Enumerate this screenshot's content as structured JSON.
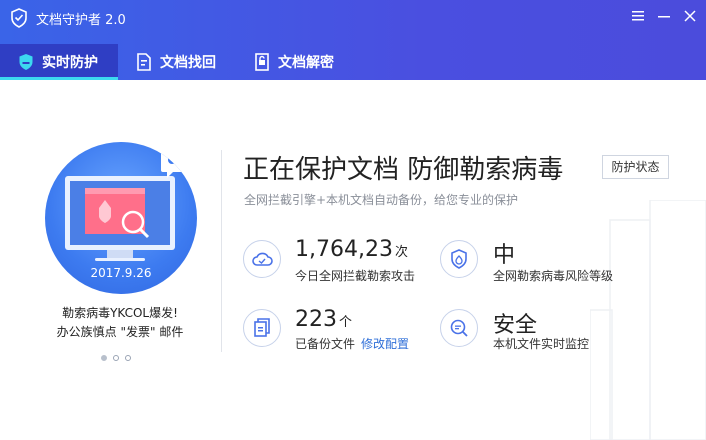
{
  "app": {
    "title": "文档守护者 2.0"
  },
  "tabs": [
    {
      "label": "实时防护",
      "icon": "shield-icon",
      "active": true
    },
    {
      "label": "文档找回",
      "icon": "document-restore-icon",
      "active": false
    },
    {
      "label": "文档解密",
      "icon": "document-unlock-icon",
      "active": false
    }
  ],
  "promo": {
    "date": "2017.9.26",
    "caption_line1": "勒索病毒YKCOL爆发!",
    "caption_line2": "办公族慎点 \"发票\" 邮件",
    "pages": 3,
    "active_page": 1
  },
  "main": {
    "headline": "正在保护文档 防御勒索病毒",
    "status_button": "防护状态",
    "subline": "全网拦截引擎+本机文档自动备份，给您专业的保护"
  },
  "stats": {
    "blocked": {
      "value": "1,764,23",
      "unit": "次",
      "label": "今日全网拦截勒索攻击"
    },
    "risk": {
      "value": "中",
      "label": "全网勒索病毒风险等级"
    },
    "backup": {
      "value": "223",
      "unit": "个",
      "label": "已备份文件",
      "link": "修改配置"
    },
    "monitor": {
      "value": "安全",
      "label": "本机文件实时监控"
    }
  },
  "colors": {
    "header": "#3a64e8",
    "accent": "#3cd9f0",
    "link": "#2f6fd8"
  }
}
